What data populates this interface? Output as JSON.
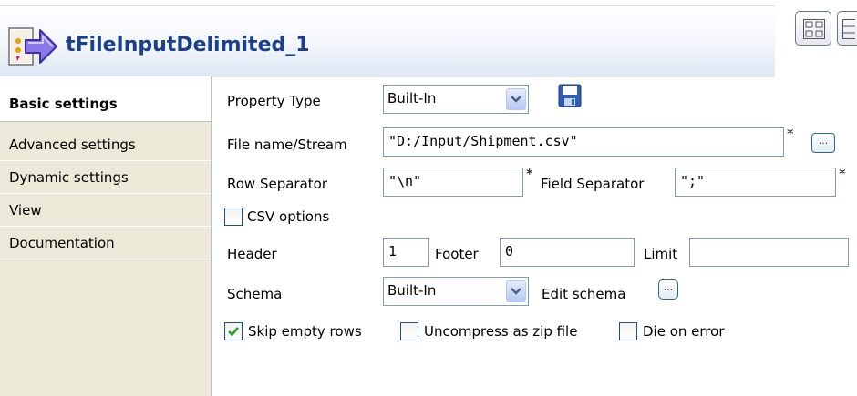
{
  "component": {
    "title": "tFileInputDelimited_1",
    "icon": "file-input-delimited-icon"
  },
  "header_buttons": [
    {
      "name": "layout-grid-button",
      "icon": "grid-layout-icon"
    },
    {
      "name": "layout-list-button",
      "icon": "list-layout-icon"
    }
  ],
  "tabs": [
    {
      "label": "Basic settings",
      "active": true
    },
    {
      "label": "Advanced settings"
    },
    {
      "label": "Dynamic settings"
    },
    {
      "label": "View"
    },
    {
      "label": "Documentation"
    }
  ],
  "form": {
    "property_type": {
      "label": "Property Type",
      "value": "Built-In",
      "save_icon": "floppy-disk-icon"
    },
    "file_name": {
      "label": "File name/Stream",
      "value": "\"D:/Input/Shipment.csv\"",
      "required": "*",
      "browse": "..."
    },
    "row_separator": {
      "label": "Row Separator",
      "value": "\"\\n\"",
      "required": "*"
    },
    "field_separator": {
      "label": "Field Separator",
      "value": "\";\"",
      "required": "*"
    },
    "csv_options": {
      "label": "CSV options",
      "checked": false
    },
    "header": {
      "label": "Header",
      "value": "1"
    },
    "footer": {
      "label": "Footer",
      "value": "0"
    },
    "limit": {
      "label": "Limit",
      "value": ""
    },
    "schema": {
      "label": "Schema",
      "value": "Built-In",
      "edit_label": "Edit schema",
      "edit_button": "..."
    },
    "skip_empty_rows": {
      "label": "Skip empty rows",
      "checked": true
    },
    "uncompress_zip": {
      "label": "Uncompress as zip file",
      "checked": false
    },
    "die_on_error": {
      "label": "Die on error",
      "checked": false
    }
  },
  "colors": {
    "title": "#1a3f8c",
    "checkmark": "#21a121",
    "sidebar_bg": "#ece9d8"
  }
}
